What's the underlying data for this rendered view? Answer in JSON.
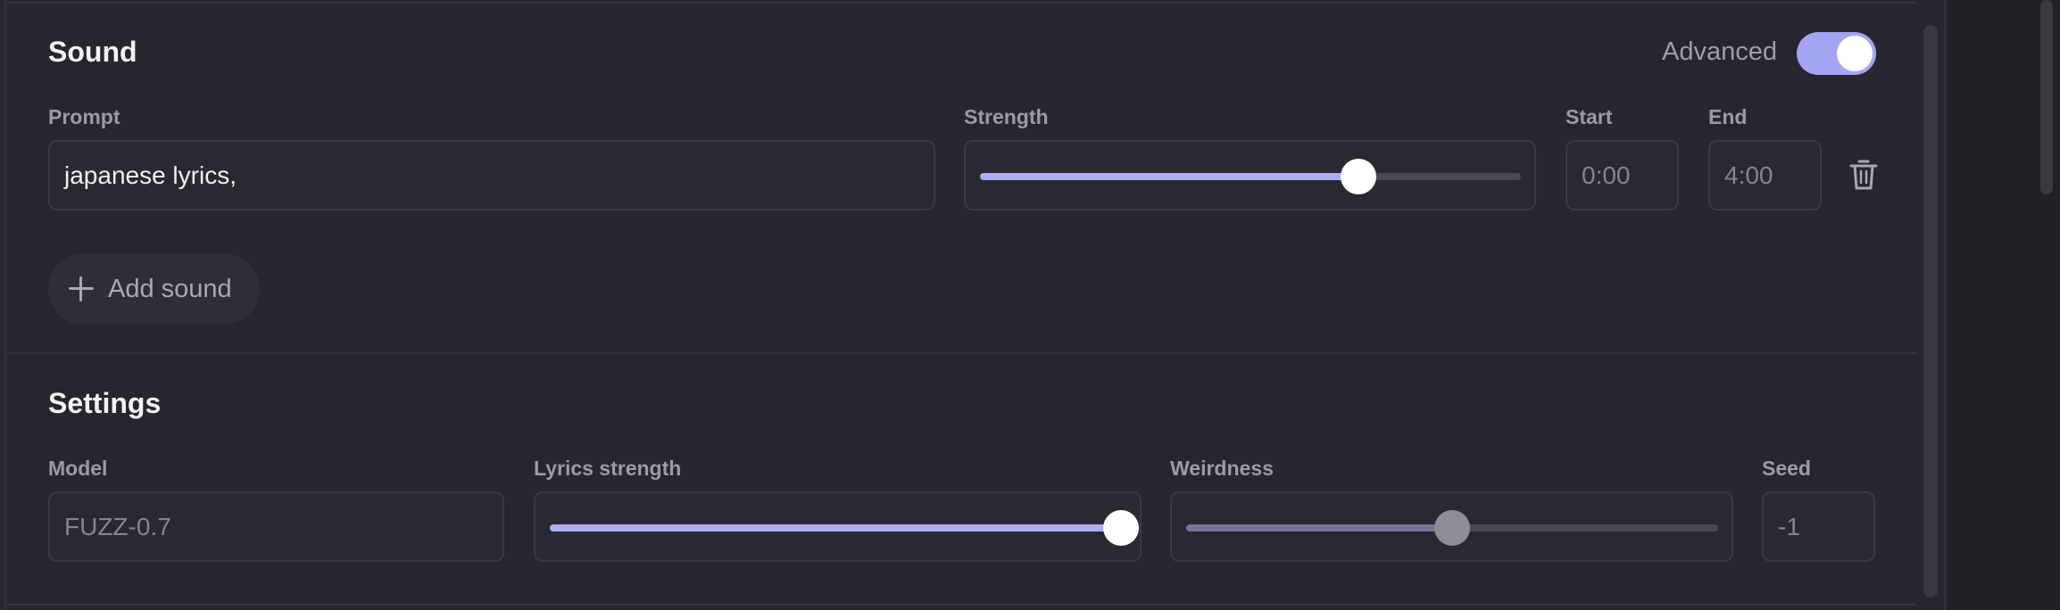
{
  "sound": {
    "title": "Sound",
    "advanced_label": "Advanced",
    "advanced_enabled": true,
    "prompt_label": "Prompt",
    "prompt_value": "japanese lyrics,",
    "strength_label": "Strength",
    "strength_value": 0.7,
    "start_label": "Start",
    "start_placeholder": "0:00",
    "end_label": "End",
    "end_placeholder": "4:00",
    "add_sound_label": "Add sound",
    "delete_icon": "trash-icon"
  },
  "settings": {
    "title": "Settings",
    "model_label": "Model",
    "model_value": "FUZZ-0.7",
    "lyrics_strength_label": "Lyrics strength",
    "lyrics_strength_value": 1.0,
    "weirdness_label": "Weirdness",
    "weirdness_value": 0.5,
    "seed_label": "Seed",
    "seed_placeholder": "-1"
  },
  "colors": {
    "background": "#27262f",
    "accent": "#adaef6",
    "text": "#f4f3f8",
    "muted_text": "#9c9aa6"
  }
}
